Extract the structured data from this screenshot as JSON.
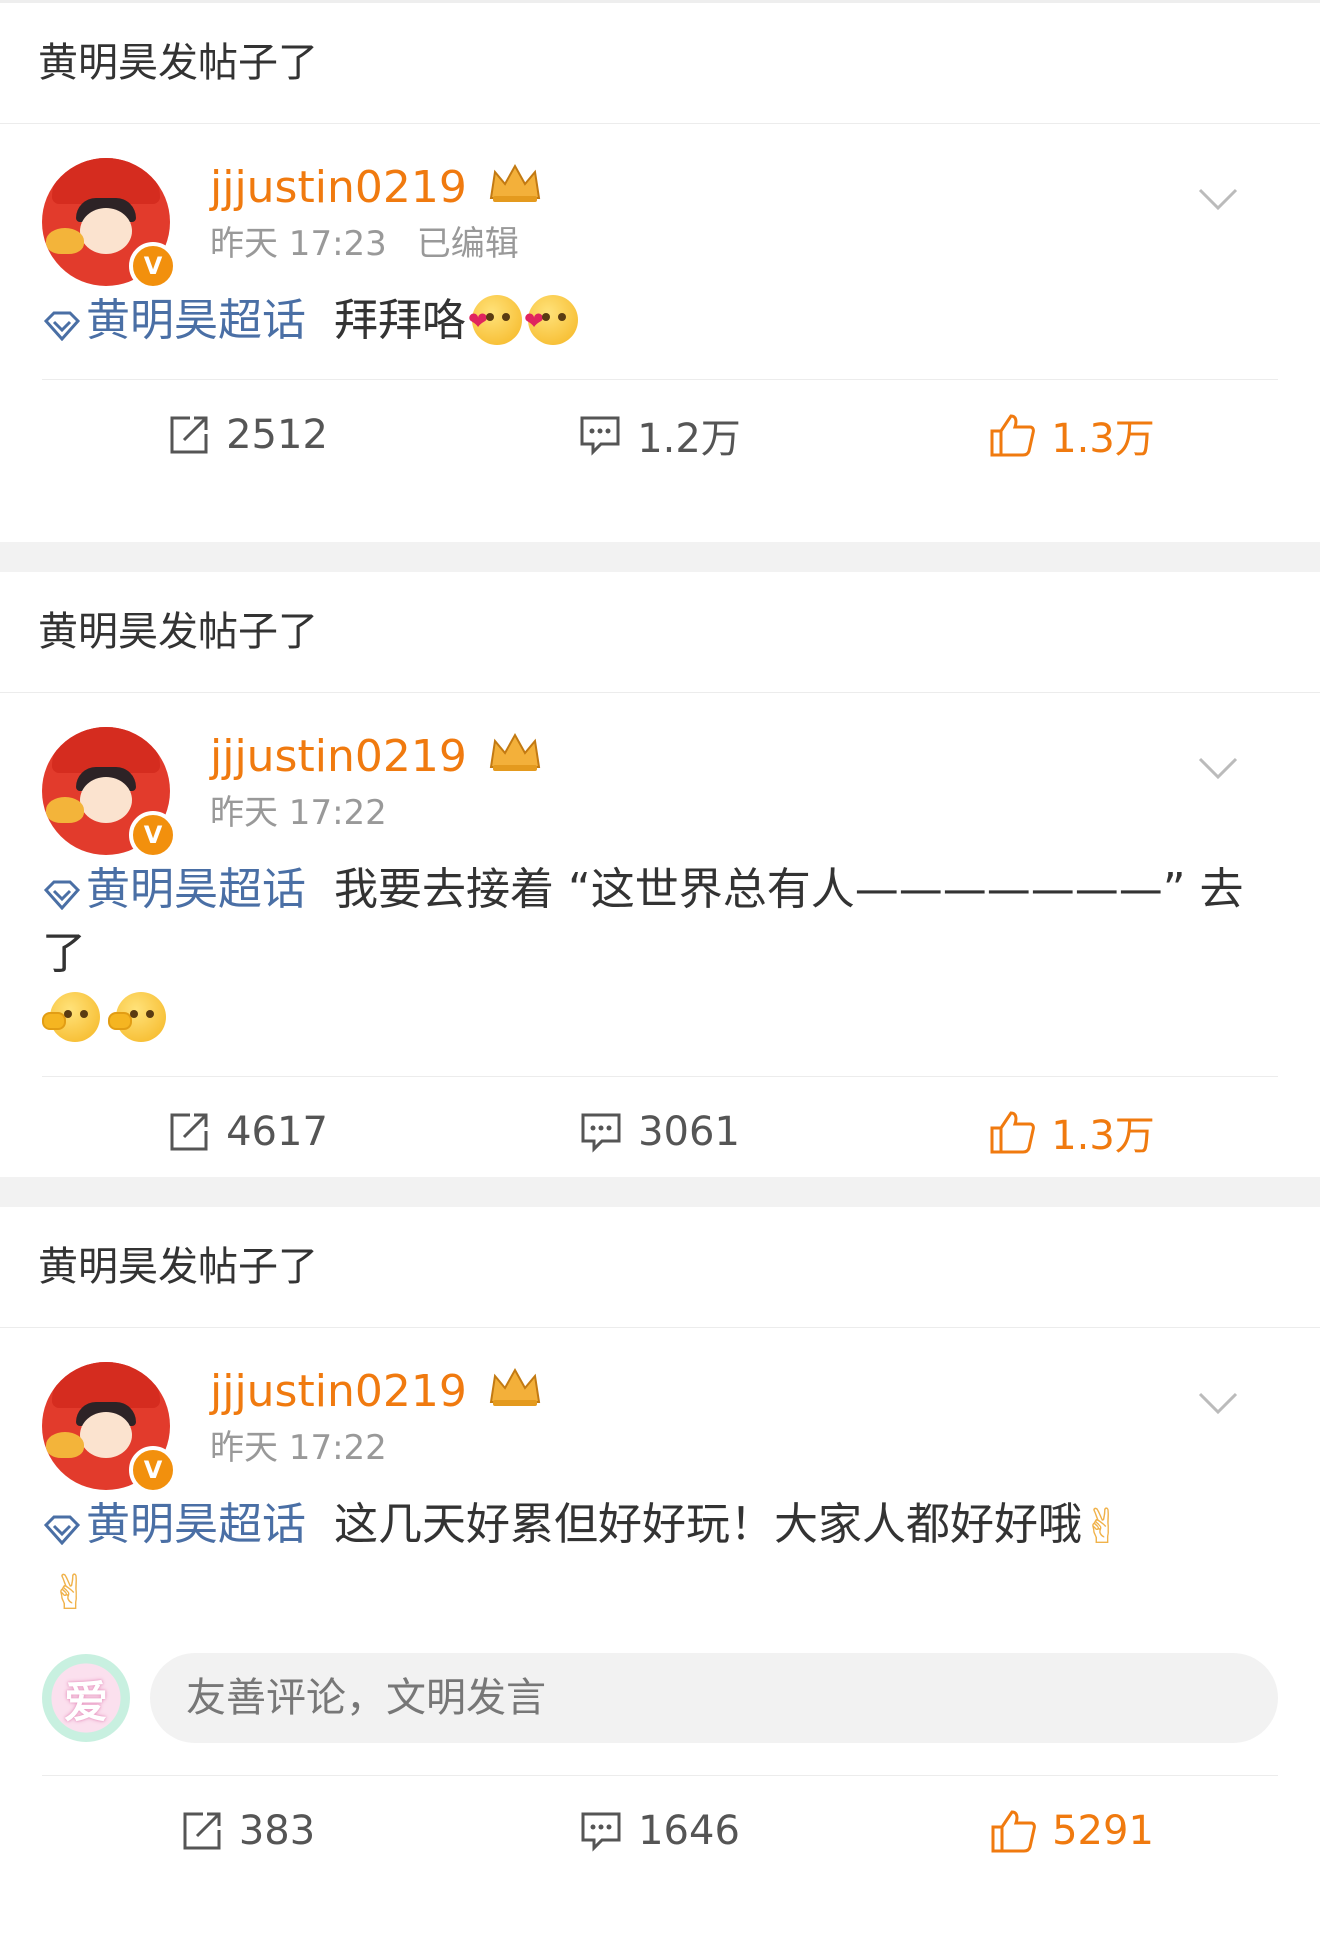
{
  "posts": [
    {
      "header": "黄明昊发帖子了",
      "username": "jjjustin0219",
      "time": "昨天 17:23",
      "edited": "已编辑",
      "topic": "黄明昊超话",
      "text": "拜拜咯",
      "text2": "",
      "emojis": [
        "heart-eyes-emoji",
        "heart-eyes-emoji"
      ],
      "reposts": "2512",
      "comments": "1.2万",
      "likes": "1.3万"
    },
    {
      "header": "黄明昊发帖子了",
      "username": "jjjustin0219",
      "time": "昨天 17:22",
      "edited": "",
      "topic": "黄明昊超话",
      "text": "我要去接着 “这世界总有人———————” 去了",
      "emojis": [
        "wink-emoji",
        "wink-emoji"
      ],
      "reposts": "4617",
      "comments": "3061",
      "likes": "1.3万"
    },
    {
      "header": "黄明昊发帖子了",
      "username": "jjjustin0219",
      "time": "昨天 17:22",
      "edited": "",
      "topic": "黄明昊超话",
      "text": "这几天好累但好好玩！大家人都好好哦",
      "emojis": [
        "victory-hand-emoji",
        "victory-hand-emoji"
      ],
      "comment_placeholder": "友善评论，文明发言",
      "me_avatar_text": "爱",
      "reposts": "383",
      "comments": "1646",
      "likes": "5291"
    }
  ],
  "colors": {
    "username": "#f07a0f",
    "topic": "#4a6fa5",
    "like": "#f07a0f",
    "badge": "#f2900d"
  }
}
